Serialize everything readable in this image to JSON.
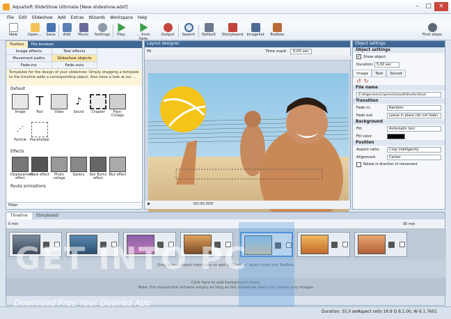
{
  "window": {
    "title": "AquaSoft SlideShow Ultimate [New slideshow.adsf]",
    "min": "–",
    "max": "□",
    "close": "×"
  },
  "menu": [
    "File",
    "Edit",
    "Slideshow",
    "Add",
    "Extras",
    "Wizards",
    "Workspace",
    "Help"
  ],
  "toolbar": [
    {
      "label": "New",
      "icon": "new-file-icon"
    },
    {
      "label": "Open...",
      "icon": "folder-open-icon"
    },
    {
      "label": "Save",
      "icon": "save-icon"
    },
    {
      "label": "Add",
      "icon": "add-icon"
    },
    {
      "label": "Music",
      "icon": "music-icon"
    },
    {
      "label": "Settings",
      "icon": "gear-icon"
    },
    {
      "label": "Play",
      "icon": "play-icon"
    },
    {
      "label": "... from here",
      "icon": "play-from-here-icon"
    },
    {
      "label": "Output",
      "icon": "output-icon"
    },
    {
      "label": "Search",
      "icon": "search-icon"
    },
    {
      "label": "Default",
      "icon": "layout-default-icon"
    },
    {
      "label": "Storyboard",
      "icon": "storyboard-icon"
    },
    {
      "label": "Imagelist",
      "icon": "imagelist-icon"
    },
    {
      "label": "Toolbox",
      "icon": "toolbox-icon"
    },
    {
      "label": "First steps",
      "icon": "first-steps-icon"
    }
  ],
  "left": {
    "tabs": [
      "Toolbox",
      "File browser"
    ],
    "subtabs": [
      "Image effects",
      "Text effects",
      "Movement paths",
      "Slideshow objects",
      "Fade-ins",
      "Fade-outs"
    ],
    "description": "Templates for the design of your slideshow: Simply dragging a template to the timeline adds a corresponding object. Also have a look at our ...",
    "default_label": "Default",
    "default_items": [
      "Image",
      "Text",
      "Video",
      "Sound",
      "Chapter",
      "Flexi-Collage",
      "Particle",
      "Placeholder"
    ],
    "effects_label": "Effects",
    "effects_items": [
      "Displacement effect",
      "Mask effect",
      "Photo collage",
      "Gallery",
      "Ken Burns effect",
      "Blur effect"
    ],
    "route_label": "Route animations",
    "filter": "Filter"
  },
  "center": {
    "title": "Layout designer",
    "zoom": "Fit",
    "time_label": "Time mark:",
    "time_value": "0,00 sec",
    "timecode": "00:00.000"
  },
  "right": {
    "title": "Object settings",
    "header": "Object settings",
    "show_object": "Show object",
    "duration_label": "Duration:",
    "duration_value": "5,00 sec",
    "tabs": [
      "Image",
      "Text",
      "Sound"
    ],
    "file_label": "File name",
    "file_value": "Z:\\Allgemein\\Graphix\\Gekauft\\ShutterStock",
    "transition_label": "Transition",
    "fadein_label": "Fade in:",
    "fadein_value": "Random",
    "fadeout_label": "Fade out:",
    "fadeout_value": "Leave in place (do not fade)",
    "background_label": "Background",
    "fill_label": "Fill:",
    "fill_value": "Automatic (on)",
    "fillcolor_label": "Fill color:",
    "position_label": "Position",
    "aspect_label": "Aspect ratio:",
    "aspect_value": "Crop intelligently",
    "align_label": "Alignment:",
    "align_value": "Center",
    "rotate_label": "Rotate in direction of movement"
  },
  "timeline": {
    "tabs": [
      "Timeline",
      "Storyboard"
    ],
    "ruler_start": "0 min",
    "ruler_end": "05 min",
    "hint1": "Drag a text object from here or add a 'Chapter' object from the Toolbox.",
    "hint2": "Click here to add background music.",
    "hint3": "Note: the musictrack remains empty as long as the slideshow does not contain any images."
  },
  "status": {
    "duration": "Duration: 35,0 sec",
    "aspect": "Aspect ratio 16:9",
    "version": "D 8.1.00, W 6.1.7601"
  },
  "watermark": {
    "main": "GET INTO PC",
    "sub": "Download Free Your Desired App"
  }
}
